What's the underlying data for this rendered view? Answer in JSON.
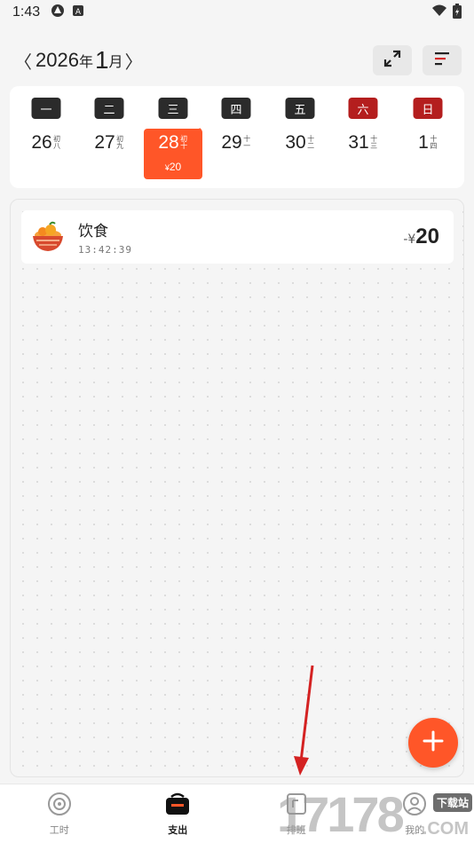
{
  "status_bar": {
    "time": "1:43"
  },
  "header": {
    "prev_label": "〈",
    "year": "2026",
    "year_unit": "年",
    "month": "1",
    "month_unit": "月",
    "next_label": "〉",
    "expand_icon": "expand-arrows-icon",
    "sort_icon": "sort-lines-icon"
  },
  "week": [
    {
      "weekday": "一",
      "day": "26",
      "lunar": "初八",
      "weekend": false,
      "selected": false
    },
    {
      "weekday": "二",
      "day": "27",
      "lunar": "初九",
      "weekend": false,
      "selected": false
    },
    {
      "weekday": "三",
      "day": "28",
      "lunar": "初十",
      "weekend": false,
      "selected": true,
      "amount_symbol": "¥",
      "amount": "20"
    },
    {
      "weekday": "四",
      "day": "29",
      "lunar": "十一",
      "weekend": false,
      "selected": false
    },
    {
      "weekday": "五",
      "day": "30",
      "lunar": "十二",
      "weekend": false,
      "selected": false
    },
    {
      "weekday": "六",
      "day": "31",
      "lunar": "十三",
      "weekend": true,
      "selected": false
    },
    {
      "weekday": "日",
      "day": "1",
      "lunar": "十四",
      "weekend": true,
      "selected": false
    }
  ],
  "entries": [
    {
      "icon": "food-bowl-icon",
      "title": "饮食",
      "time": "13:42:39",
      "sign": "-¥",
      "amount": "20"
    }
  ],
  "fab": {
    "icon": "plus-icon"
  },
  "bottom_nav": [
    {
      "label": "工时",
      "icon": "clock-icon",
      "active": false
    },
    {
      "label": "支出",
      "icon": "wallet-icon",
      "active": true
    },
    {
      "label": "排班",
      "icon": "calendar-icon",
      "active": false
    },
    {
      "label": "我的",
      "icon": "user-icon",
      "active": false
    }
  ],
  "watermark": {
    "digits": "17178",
    "badge": "下载站",
    "suffix": ".COM"
  },
  "colors": {
    "accent": "#ff5628",
    "weekend": "#b41e1e",
    "dark_badge": "#2b2b2b"
  }
}
